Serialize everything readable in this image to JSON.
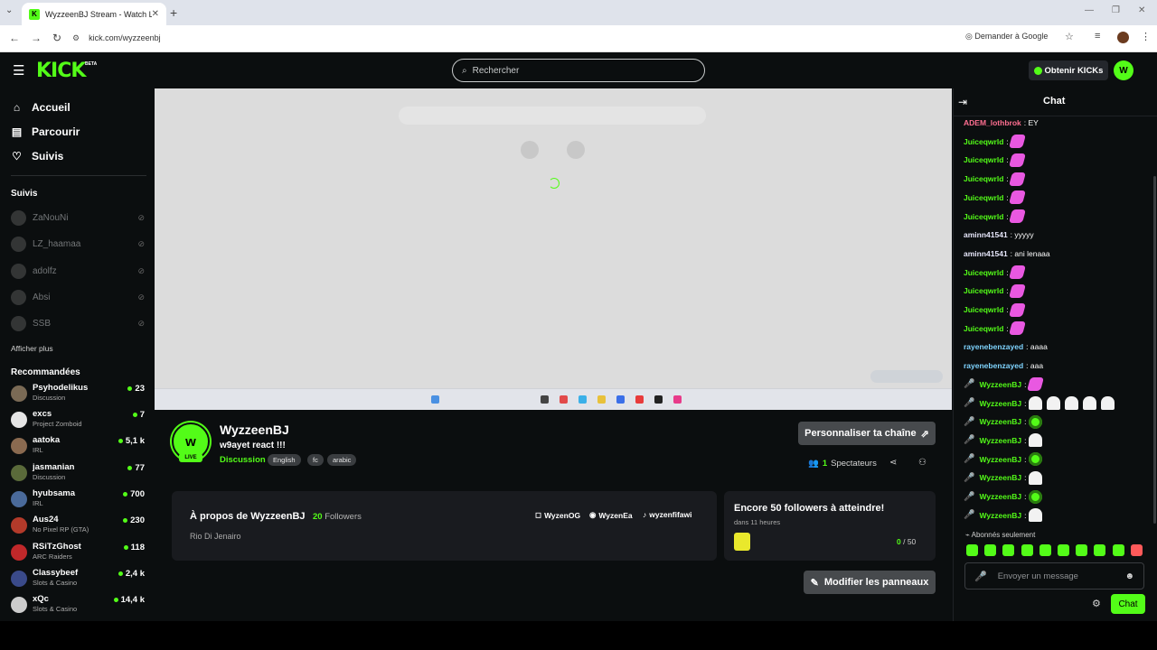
{
  "browser": {
    "tab_title": "WyzzeenBJ Stream - Watch Live",
    "url": "kick.com/wyzzeenbj",
    "translate_label": "Demander à Google",
    "favicon_letter": "K"
  },
  "header": {
    "logo": "KICK",
    "beta": "BETA",
    "search_placeholder": "Rechercher",
    "get_kicks": "Obtenir KICKs",
    "brand_color": "#53fc18"
  },
  "sidebar": {
    "nav": [
      {
        "label": "Accueil",
        "icon": "home-icon"
      },
      {
        "label": "Parcourir",
        "icon": "browse-icon"
      },
      {
        "label": "Suivis",
        "icon": "heart-icon"
      }
    ],
    "following_title": "Suivis",
    "following": [
      "ZaNouNi",
      "LZ_haamaa",
      "adolfz",
      "Absi",
      "SSB"
    ],
    "show_more": "Afficher plus",
    "recommended_title": "Recommandées",
    "recommended": [
      {
        "name": "Psyhodelikus",
        "category": "Discussion",
        "viewers": "23"
      },
      {
        "name": "excs",
        "category": "Project Zomboid",
        "viewers": "7"
      },
      {
        "name": "aatoka",
        "category": "IRL",
        "viewers": "5,1 k"
      },
      {
        "name": "jasmanian",
        "category": "Discussion",
        "viewers": "77"
      },
      {
        "name": "hyubsama",
        "category": "IRL",
        "viewers": "700"
      },
      {
        "name": "Aus24",
        "category": "No Pixel RP (GTA)",
        "viewers": "230"
      },
      {
        "name": "RSiTzGhost",
        "category": "ARC Raiders",
        "viewers": "118"
      },
      {
        "name": "Classybeef",
        "category": "Slots & Casino",
        "viewers": "2,4 k"
      },
      {
        "name": "xQc",
        "category": "Slots & Casino",
        "viewers": "14,4 k"
      }
    ]
  },
  "channel": {
    "name": "WyzzeenBJ",
    "title": "w9ayet react !!!",
    "category": "Discussion",
    "tags": [
      "English",
      "fc",
      "arabic"
    ],
    "live": "LIVE",
    "customize": "Personnaliser ta chaîne",
    "viewers_count": "1",
    "viewers_label": "Spectateurs",
    "avatar_letters": "w"
  },
  "about": {
    "title": "À propos de WyzzeenBJ",
    "followers_count": "20",
    "followers_label": "Followers",
    "location": "Rio Di Jenairo",
    "socials": [
      "WyzenOG",
      "WyzenEa",
      "wyzenfifawi"
    ]
  },
  "goal": {
    "title": "Encore 50 followers à atteindre!",
    "subtitle": "dans 11 heures",
    "current": "0",
    "target": " / 50"
  },
  "edit_panels": "Modifier les panneaux",
  "chat": {
    "title": "Chat",
    "messages": [
      {
        "user": "ADEM_lothbrok",
        "color": "#ff6f91",
        "text": "EY",
        "mic": false,
        "emotes": []
      },
      {
        "user": "Juiceqwrld",
        "color": "#53fc18",
        "text": "",
        "mic": false,
        "emotes": [
          "pink"
        ]
      },
      {
        "user": "Juiceqwrld",
        "color": "#53fc18",
        "text": "",
        "mic": false,
        "emotes": [
          "pink"
        ]
      },
      {
        "user": "Juiceqwrld",
        "color": "#53fc18",
        "text": "",
        "mic": false,
        "emotes": [
          "pink"
        ]
      },
      {
        "user": "Juiceqwrld",
        "color": "#53fc18",
        "text": "",
        "mic": false,
        "emotes": [
          "pink"
        ]
      },
      {
        "user": "Juiceqwrld",
        "color": "#53fc18",
        "text": "",
        "mic": false,
        "emotes": [
          "pink"
        ]
      },
      {
        "user": "aminn41541",
        "color": "#e6e6fa",
        "text": "yyyyy",
        "mic": false,
        "emotes": []
      },
      {
        "user": "aminn41541",
        "color": "#e6e6fa",
        "text": "ani lenaaa",
        "mic": false,
        "emotes": []
      },
      {
        "user": "Juiceqwrld",
        "color": "#53fc18",
        "text": "",
        "mic": false,
        "emotes": [
          "pink"
        ]
      },
      {
        "user": "Juiceqwrld",
        "color": "#53fc18",
        "text": "",
        "mic": false,
        "emotes": [
          "pink"
        ]
      },
      {
        "user": "Juiceqwrld",
        "color": "#53fc18",
        "text": "",
        "mic": false,
        "emotes": [
          "pink"
        ]
      },
      {
        "user": "Juiceqwrld",
        "color": "#53fc18",
        "text": "",
        "mic": false,
        "emotes": [
          "pink"
        ]
      },
      {
        "user": "rayenebenzayed",
        "color": "#7fd4ff",
        "text": "aaaa",
        "mic": false,
        "emotes": []
      },
      {
        "user": "rayenebenzayed",
        "color": "#7fd4ff",
        "text": "aaa",
        "mic": false,
        "emotes": []
      },
      {
        "user": "WyzzeenBJ",
        "color": "#53fc18",
        "text": "",
        "mic": true,
        "emotes": [
          "pink"
        ]
      },
      {
        "user": "WyzzeenBJ",
        "color": "#53fc18",
        "text": "",
        "mic": true,
        "emotes": [
          "ghost",
          "ghost",
          "ghost",
          "ghost",
          "ghost"
        ]
      },
      {
        "user": "WyzzeenBJ",
        "color": "#53fc18",
        "text": "",
        "mic": true,
        "emotes": [
          "green"
        ]
      },
      {
        "user": "WyzzeenBJ",
        "color": "#53fc18",
        "text": "",
        "mic": true,
        "emotes": [
          "ghost"
        ]
      },
      {
        "user": "WyzzeenBJ",
        "color": "#53fc18",
        "text": "",
        "mic": true,
        "emotes": [
          "green"
        ]
      },
      {
        "user": "WyzzeenBJ",
        "color": "#53fc18",
        "text": "",
        "mic": true,
        "emotes": [
          "ghost"
        ]
      },
      {
        "user": "WyzzeenBJ",
        "color": "#53fc18",
        "text": "",
        "mic": true,
        "emotes": [
          "green"
        ]
      },
      {
        "user": "WyzzeenBJ",
        "color": "#53fc18",
        "text": "",
        "mic": true,
        "emotes": [
          "ghost"
        ]
      }
    ],
    "subs_only": "Abonnés seulement",
    "input_placeholder": "Envoyer un message",
    "send": "Chat"
  }
}
